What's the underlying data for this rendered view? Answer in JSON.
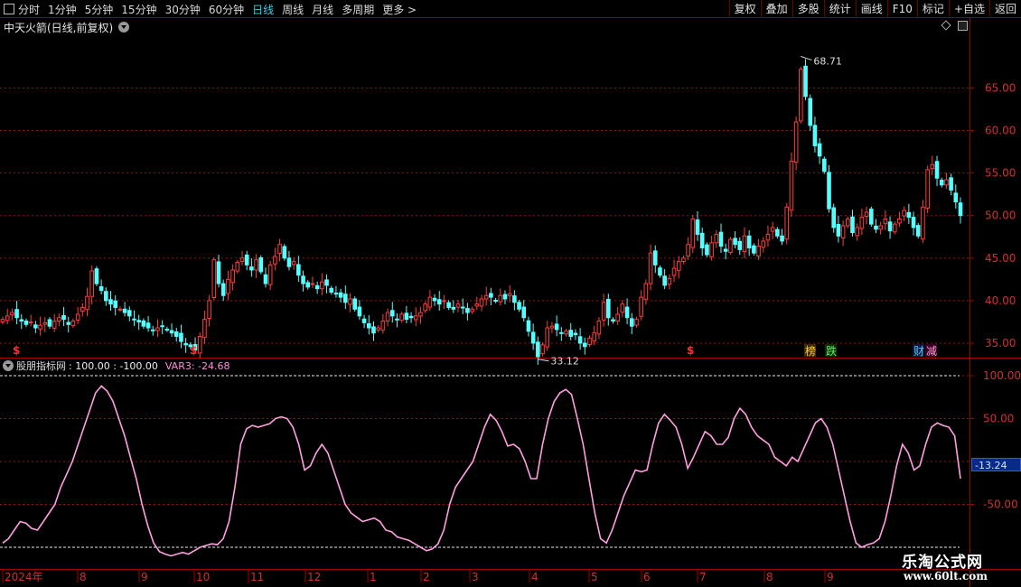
{
  "toolbar": {
    "periods": [
      "分时",
      "1分钟",
      "5分钟",
      "15分钟",
      "30分钟",
      "60分钟",
      "日线",
      "周线",
      "月线",
      "多周期",
      "更多 >"
    ],
    "active_period": "日线",
    "right_buttons": [
      "复权",
      "叠加",
      "多股",
      "统计",
      "画线",
      "F10",
      "标记",
      "+自选",
      "返回"
    ]
  },
  "main_chart": {
    "title": "中天火箭(日线,前复权)",
    "high_label": "68.71",
    "low_label": "33.12",
    "price_ticks": [
      "65.00",
      "60.00",
      "55.00",
      "50.00",
      "45.00",
      "40.00",
      "35.00"
    ],
    "markers": [
      "$",
      "$",
      "$"
    ],
    "event_tags": [
      "榜",
      "跌",
      "财",
      "减"
    ]
  },
  "indicator": {
    "name": "股朋指标网",
    "values_text": ": 100.00  : -100.00",
    "var3_label": "VAR3: -24.68",
    "ticks": [
      "100.00",
      "50.00",
      "-50.00"
    ],
    "current_value": "-13.24"
  },
  "time_axis": {
    "labels": [
      "2024年",
      "8",
      "9",
      "10",
      "11",
      "12",
      "1",
      "2",
      "3",
      "4",
      "5",
      "6",
      "7",
      "8",
      "9"
    ]
  },
  "watermark": {
    "line1": "乐淘公式网",
    "line2": "www.60lt.com"
  },
  "colors": {
    "up": "#ff3c3c",
    "down": "#54ffff",
    "indicator_line": "#ff9fe0",
    "grid": "#a01010",
    "active": "#39d0e8"
  },
  "chart_data": {
    "type": "candlestick",
    "price_range": [
      31,
      70
    ],
    "indicator_range": [
      -110,
      110
    ],
    "closes": [
      37.8,
      38.2,
      38.6,
      38.0,
      37.6,
      37.2,
      37.5,
      36.8,
      37.1,
      37.4,
      37.0,
      37.6,
      38.0,
      37.8,
      37.2,
      37.6,
      38.4,
      39.2,
      40.5,
      43.5,
      42.0,
      41.2,
      40.0,
      39.6,
      39.2,
      39.0,
      38.6,
      38.2,
      37.8,
      37.5,
      37.0,
      36.8,
      36.5,
      36.8,
      37.0,
      36.6,
      36.2,
      35.8,
      35.2,
      34.8,
      34.6,
      34.2,
      35.8,
      37.8,
      40.0,
      44.8,
      42.0,
      40.6,
      42.5,
      43.6,
      44.5,
      45.0,
      44.2,
      43.6,
      44.8,
      43.4,
      42.0,
      44.2,
      45.2,
      46.6,
      45.0,
      44.0,
      44.6,
      43.0,
      42.0,
      41.6,
      42.0,
      41.4,
      42.2,
      41.8,
      41.0,
      40.8,
      40.4,
      39.8,
      40.2,
      39.0,
      38.2,
      37.4,
      36.8,
      36.2,
      36.8,
      37.6,
      38.6,
      38.2,
      37.8,
      38.4,
      37.8,
      38.0,
      38.2,
      38.6,
      39.6,
      40.4,
      40.0,
      39.6,
      40.0,
      39.2,
      39.0,
      39.6,
      39.2,
      38.6,
      39.0,
      39.6,
      40.2,
      40.6,
      40.4,
      40.0,
      40.6,
      40.2,
      40.8,
      39.8,
      39.0,
      38.0,
      36.4,
      35.0,
      33.4,
      34.8,
      36.8,
      37.0,
      36.6,
      36.2,
      36.4,
      35.8,
      36.0,
      35.0,
      34.6,
      35.6,
      36.2,
      37.6,
      39.8,
      38.0,
      37.6,
      38.4,
      39.6,
      38.0,
      37.0,
      37.8,
      40.4,
      42.0,
      45.6,
      44.2,
      43.0,
      41.8,
      42.6,
      43.8,
      44.6,
      45.0,
      46.6,
      49.6,
      47.8,
      46.2,
      45.4,
      46.8,
      47.8,
      46.4,
      45.8,
      47.2,
      46.6,
      46.0,
      47.6,
      46.2,
      45.6,
      46.4,
      47.0,
      47.8,
      48.6,
      47.6,
      47.0,
      51.0,
      56.4,
      61.0,
      67.2,
      64.0,
      60.6,
      58.2,
      57.0,
      55.2,
      50.8,
      48.6,
      47.6,
      48.8,
      49.6,
      48.0,
      48.6,
      49.8,
      50.4,
      49.0,
      48.4,
      48.8,
      49.6,
      48.2,
      49.0,
      49.6,
      50.6,
      49.8,
      48.6,
      47.6,
      51.0,
      55.4,
      56.0,
      54.4,
      53.6,
      54.2,
      53.0,
      51.6,
      50.0
    ],
    "indicator_values": [
      -95,
      -90,
      -80,
      -70,
      -72,
      -78,
      -80,
      -70,
      -60,
      -50,
      -30,
      -15,
      0,
      20,
      40,
      60,
      80,
      88,
      82,
      70,
      50,
      30,
      5,
      -20,
      -50,
      -75,
      -95,
      -105,
      -108,
      -110,
      -108,
      -106,
      -108,
      -104,
      -100,
      -98,
      -96,
      -97,
      -90,
      -70,
      -30,
      20,
      38,
      42,
      40,
      42,
      44,
      50,
      52,
      50,
      40,
      20,
      -10,
      -5,
      10,
      20,
      10,
      -10,
      -30,
      -50,
      -60,
      -65,
      -70,
      -68,
      -66,
      -70,
      -80,
      -82,
      -88,
      -90,
      -92,
      -96,
      -100,
      -104,
      -102,
      -96,
      -80,
      -50,
      -30,
      -20,
      -10,
      0,
      20,
      40,
      55,
      48,
      35,
      18,
      20,
      15,
      0,
      -20,
      -20,
      20,
      50,
      70,
      80,
      84,
      78,
      50,
      20,
      -20,
      -60,
      -90,
      -95,
      -80,
      -60,
      -40,
      -25,
      -10,
      -12,
      -10,
      20,
      45,
      55,
      48,
      40,
      20,
      -8,
      5,
      20,
      35,
      30,
      20,
      20,
      28,
      50,
      62,
      55,
      40,
      30,
      25,
      20,
      5,
      0,
      -5,
      5,
      0,
      15,
      30,
      45,
      50,
      40,
      20,
      -10,
      -40,
      -70,
      -95,
      -100,
      -97,
      -95,
      -90,
      -70,
      -40,
      -5,
      20,
      10,
      -10,
      -5,
      20,
      40,
      45,
      42,
      40,
      30,
      -20
    ],
    "sample_note": ""
  }
}
